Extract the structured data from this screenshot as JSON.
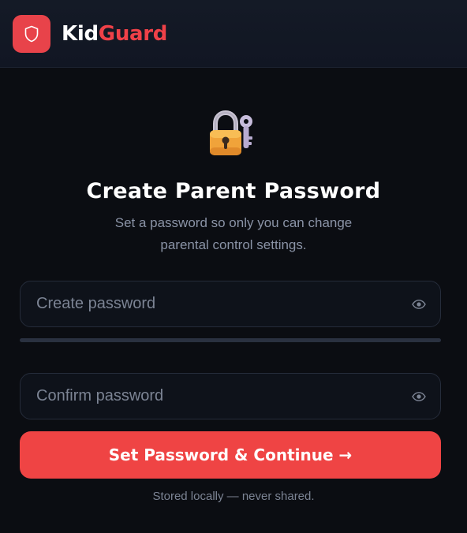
{
  "header": {
    "brand_part1": "Kid",
    "brand_part2": "Guard",
    "logo_icon": "shield-icon"
  },
  "main": {
    "icon": "lock-with-key-icon",
    "title": "Create Parent Password",
    "subtitle": "Set a password so only you can change parental control settings.",
    "create_password": {
      "placeholder": "Create password",
      "value": ""
    },
    "confirm_password": {
      "placeholder": "Confirm password",
      "value": ""
    },
    "strength": 0,
    "cta_label": "Set Password & Continue →",
    "footnote": "Stored locally — never shared."
  },
  "colors": {
    "accent": "#ef4444",
    "brand_red": "#ef4148",
    "background": "#0b0d12",
    "muted_text": "#8a93a6"
  }
}
